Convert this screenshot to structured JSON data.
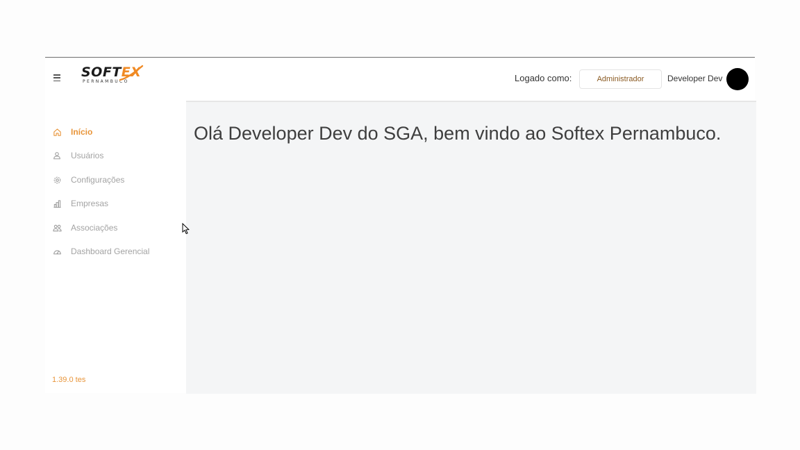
{
  "header": {
    "menu_icon": "hamburger-icon",
    "logo": {
      "word_main": "SOFT",
      "word_accent": "EX",
      "subtitle": "PERNAMBUCO"
    },
    "logged_as_label": "Logado como:",
    "role": "Administrador",
    "user_name": "Developer Dev"
  },
  "sidebar": {
    "items": [
      {
        "label": "Início",
        "icon": "home-icon",
        "active": true
      },
      {
        "label": "Usuários",
        "icon": "user-icon",
        "active": false
      },
      {
        "label": "Configurações",
        "icon": "gear-icon",
        "active": false
      },
      {
        "label": "Empresas",
        "icon": "building-icon",
        "active": false
      },
      {
        "label": "Associações",
        "icon": "users-icon",
        "active": false
      },
      {
        "label": "Dashboard Gerencial",
        "icon": "dashboard-icon",
        "active": false
      }
    ],
    "version": "1.39.0 tes"
  },
  "main": {
    "welcome": "Olá Developer Dev do SGA, bem vindo ao Softex Pernambuco."
  },
  "colors": {
    "accent": "#e8953a",
    "logo_accent": "#f08a24",
    "content_bg": "#f4f5f6",
    "inactive_text": "#a3a3a3"
  }
}
